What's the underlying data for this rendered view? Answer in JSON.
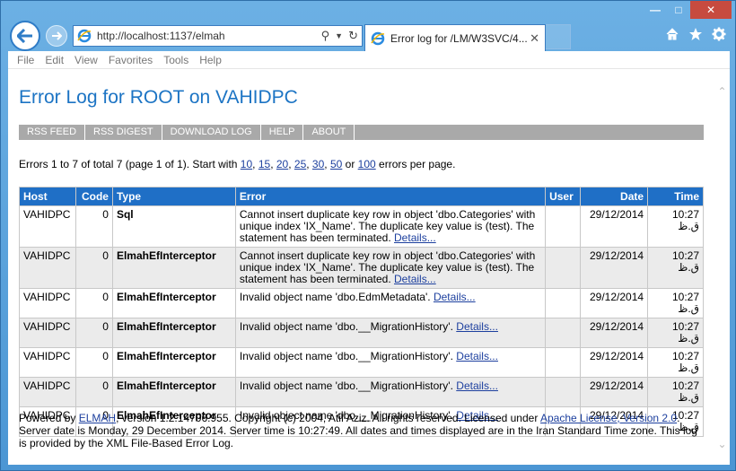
{
  "browser": {
    "address_url": "http://localhost:1137/elmah",
    "tab_title": "Error log for /LM/W3SVC/4...",
    "menu": [
      "File",
      "Edit",
      "View",
      "Favorites",
      "Tools",
      "Help"
    ]
  },
  "page": {
    "title": "Error Log for ROOT on VAHIDPC",
    "speedbar": [
      "RSS FEED",
      "RSS DIGEST",
      "DOWNLOAD LOG",
      "HELP",
      "ABOUT"
    ],
    "pagesize_prefix": "Errors 1 to 7 of total 7 (page 1 of 1). Start with",
    "pagesize_options": [
      "10",
      "15",
      "20",
      "25",
      "30",
      "50",
      "100"
    ],
    "pagesize_or": "or",
    "pagesize_suffix": "errors per page.",
    "columns": [
      "Host",
      "Code",
      "Type",
      "Error",
      "User",
      "Date",
      "Time"
    ],
    "rows": [
      {
        "host": "VAHIDPC",
        "code": "0",
        "type": "Sql",
        "error": "Cannot insert duplicate key row in object 'dbo.Categories' with unique index 'IX_Name'. The duplicate key value is (test). The statement has been terminated.",
        "details": "Details...",
        "user": "",
        "date": "29/12/2014",
        "time": "10:27 ق.ظ"
      },
      {
        "host": "VAHIDPC",
        "code": "0",
        "type": "ElmahEfInterceptor",
        "error": "Cannot insert duplicate key row in object 'dbo.Categories' with unique index 'IX_Name'. The duplicate key value is (test). The statement has been terminated.",
        "details": "Details...",
        "user": "",
        "date": "29/12/2014",
        "time": "10:27 ق.ظ"
      },
      {
        "host": "VAHIDPC",
        "code": "0",
        "type": "ElmahEfInterceptor",
        "error": "Invalid object name 'dbo.EdmMetadata'.",
        "details": "Details...",
        "user": "",
        "date": "29/12/2014",
        "time": "10:27 ق.ظ"
      },
      {
        "host": "VAHIDPC",
        "code": "0",
        "type": "ElmahEfInterceptor",
        "error": "Invalid object name 'dbo.__MigrationHistory'.",
        "details": "Details...",
        "user": "",
        "date": "29/12/2014",
        "time": "10:27 ق.ظ"
      },
      {
        "host": "VAHIDPC",
        "code": "0",
        "type": "ElmahEfInterceptor",
        "error": "Invalid object name 'dbo.__MigrationHistory'.",
        "details": "Details...",
        "user": "",
        "date": "29/12/2014",
        "time": "10:27 ق.ظ"
      },
      {
        "host": "VAHIDPC",
        "code": "0",
        "type": "ElmahEfInterceptor",
        "error": "Invalid object name 'dbo.__MigrationHistory'.",
        "details": "Details...",
        "user": "",
        "date": "29/12/2014",
        "time": "10:27 ق.ظ"
      },
      {
        "host": "VAHIDPC",
        "code": "0",
        "type": "ElmahEfInterceptor",
        "error": "Invalid object name 'dbo.__MigrationHistory'.",
        "details": "Details...",
        "user": "",
        "date": "29/12/2014",
        "time": "10:27 ق.ظ"
      }
    ],
    "footer": {
      "powered_by": "Powered by",
      "elmah_link": "ELMAH",
      "text1": ", version 1.2.14706.955. Copyright (c) 2004, Atif Aziz. All rights reserved. Licensed under",
      "license_link": "Apache License, Version 2.0",
      "text2": ". Server date is Monday, 29 December 2014. Server time is 10:27:49. All dates and times displayed are in the Iran Standard Time zone. This log is provided by the XML File-Based Error Log."
    }
  },
  "colors": {
    "title": "#1c74c4",
    "header_bg": "#1f6fc6",
    "speedbar_bg": "#a9a9a9",
    "link": "#1c3f9e"
  },
  "icons": [
    "back-arrow-icon",
    "forward-arrow-icon",
    "ie-logo-icon",
    "search-icon",
    "refresh-icon",
    "home-icon",
    "favorites-star-icon",
    "settings-gear-icon",
    "minimize-icon",
    "maximize-icon",
    "close-icon"
  ]
}
